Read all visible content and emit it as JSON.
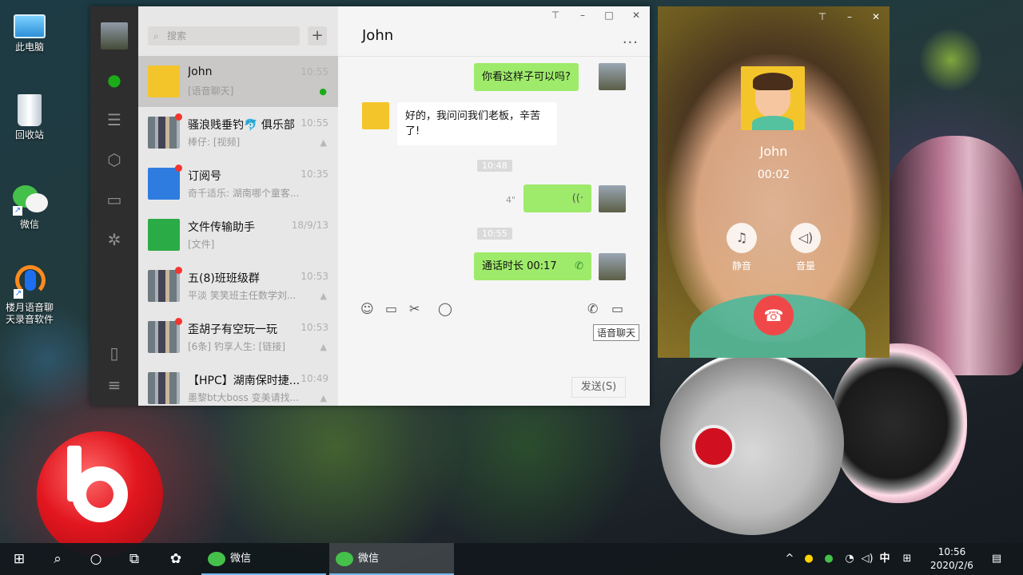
{
  "desktop": {
    "icons": [
      {
        "label": "此电脑"
      },
      {
        "label": "回收站"
      },
      {
        "label": "微信"
      },
      {
        "label": "楼月语音聊天录音软件"
      }
    ]
  },
  "wechat": {
    "search": {
      "placeholder": "搜索"
    },
    "add_label": "+",
    "conversations": [
      {
        "name": "John",
        "preview": "[语音聊天]",
        "time": "10:55"
      },
      {
        "name": "骚浪贱垂钓🐬 俱乐部",
        "preview": "棒仔: [视频]",
        "time": "10:55"
      },
      {
        "name": "订阅号",
        "preview": "奇千适乐: 湖南哪个童客...",
        "time": "10:35"
      },
      {
        "name": "文件传输助手",
        "preview": "[文件]",
        "time": "18/9/13"
      },
      {
        "name": "五(8)班班级群",
        "preview": "平淡 笑笑班主任数学刘...",
        "time": "10:53"
      },
      {
        "name": "歪胡子有空玩一玩",
        "preview": "[6条] 钓享人生: [链接]",
        "time": "10:53"
      },
      {
        "name": "【HPC】湖南保时捷...",
        "preview": "墨黎bt大boss 变美请找...",
        "time": "10:49"
      }
    ],
    "chat": {
      "title": "John",
      "more": "...",
      "messages": {
        "m1": "你看这样子可以吗?",
        "m2": "好的，我问问我们老板，辛苦了!",
        "t1": "10:48",
        "voice_duration": "4\"",
        "t2": "10:55",
        "m3": "通话时长 00:17"
      },
      "tooltip": "语音聊天",
      "send_label": "发送(S)"
    }
  },
  "call": {
    "name": "John",
    "duration": "00:02",
    "mute_label": "静音",
    "volume_label": "音量"
  },
  "taskbar": {
    "apps": [
      {
        "label": "微信"
      },
      {
        "label": "微信"
      }
    ],
    "ime": "中",
    "time": "10:56",
    "date": "2020/2/6"
  }
}
